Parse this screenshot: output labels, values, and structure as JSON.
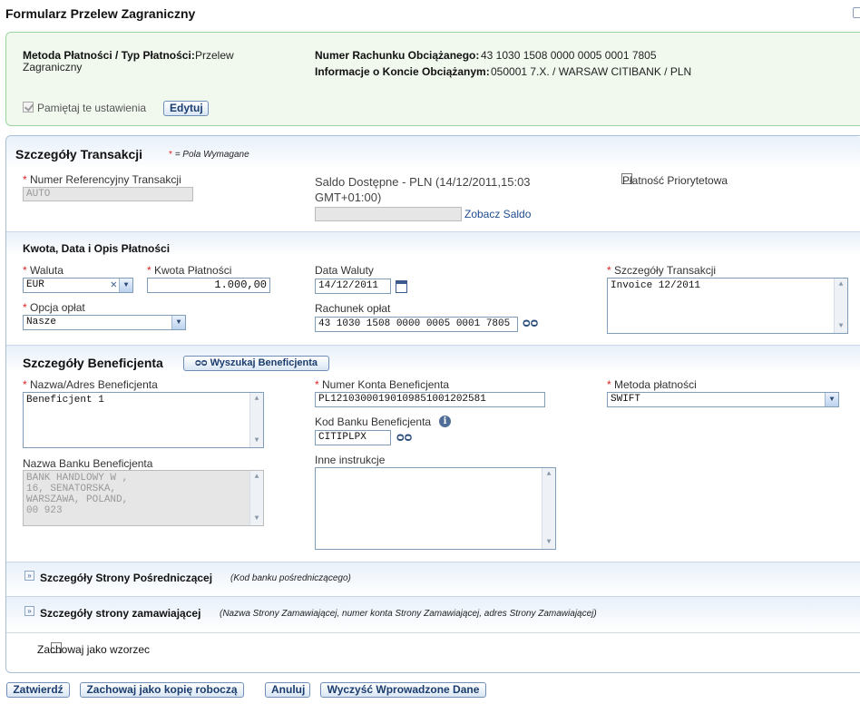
{
  "page": {
    "title": "Formularz Przelew Zagraniczny"
  },
  "settings": {
    "payment_method_label": "Metoda Płatności / Typ Płatności:",
    "payment_method_value_1": "Przelew",
    "payment_method_value_2": "Zagraniczny",
    "account_number_label": "Numer Rachunku Obciążanego:",
    "account_number_value": "43 1030 1508 0000 0005 0001 7805",
    "account_info_label": "Informacje o Koncie Obciążanym:",
    "account_info_value": "050001 7.X. / WARSAW CITIBANK / PLN",
    "remember_label": "Pamiętaj te ustawienia",
    "remember_checked": true,
    "edit_button": "Edytuj"
  },
  "transaction": {
    "section_title": "Szczegóły Transakcji",
    "required_note": "= Pola Wymagane",
    "required_marker": "*",
    "ref_label": "Numer Referencyjny Transakcji",
    "ref_value": "AUTO",
    "balance_label_1": "Saldo Dostępne - PLN (14/12/2011,15:03",
    "balance_label_2": "GMT+01:00)",
    "balance_value": "",
    "see_balance_link": "Zobacz Saldo",
    "priority_label": "Płatność Priorytetowa",
    "priority_checked": false
  },
  "amount": {
    "subsection_title": "Kwota, Data i Opis Płatności",
    "currency_label": "Waluta",
    "currency_value": "EUR",
    "amount_label": "Kwota Płatności",
    "amount_value": "1.000,00",
    "value_date_label": "Data Waluty",
    "value_date_value": "14/12/2011",
    "details_label": "Szczegóły Transakcji",
    "details_value": "Invoice 12/2011",
    "fee_option_label": "Opcja opłat",
    "fee_option_value": "Nasze",
    "fee_account_label": "Rachunek opłat",
    "fee_account_value": "43 1030 1508 0000 0005 0001 7805"
  },
  "beneficiary": {
    "section_title": "Szczegóły Beneficjenta",
    "search_button": "Wyszukaj Beneficjenta",
    "name_label": "Nazwa/Adres Beneficjenta",
    "name_value": "Beneficjent 1",
    "account_label": "Numer Konta Beneficjenta",
    "account_value": "PL12103000190109851001202581",
    "method_label": "Metoda płatności",
    "method_value": "SWIFT",
    "bank_code_label": "Kod Banku Beneficjenta",
    "bank_code_value": "CITIPLPX",
    "bank_name_label": "Nazwa Banku Beneficjenta",
    "bank_name_value": "BANK HANDLOWY W ,\n16, SENATORSKA,\nWARSZAWA, POLAND,\n00 923",
    "other_instructions_label": "Inne instrukcje",
    "other_instructions_value": ""
  },
  "intermediary": {
    "title": "Szczegóły Strony Pośredniczącej",
    "note": "(Kod banku pośredniczącego)"
  },
  "ordering": {
    "title": "Szczegóły strony zamawiającej",
    "note": "(Nazwa Strony Zamawiającej, numer konta Strony Zamawiającej, adres Strony Zamawiającej)"
  },
  "template": {
    "save_as_template_label": "Zachowaj jako wzorzec",
    "checked": false
  },
  "actions": {
    "approve": "Zatwierdź",
    "save_draft": "Zachowaj jako kopię roboczą",
    "cancel": "Anuluj",
    "clear": "Wyczyść Wprowadzone Dane"
  },
  "colors": {
    "panel_green_bg": "#f1f9ef",
    "panel_green_border": "#9cd49c",
    "required_red": "#d22",
    "link_blue": "#1f4c8f"
  }
}
